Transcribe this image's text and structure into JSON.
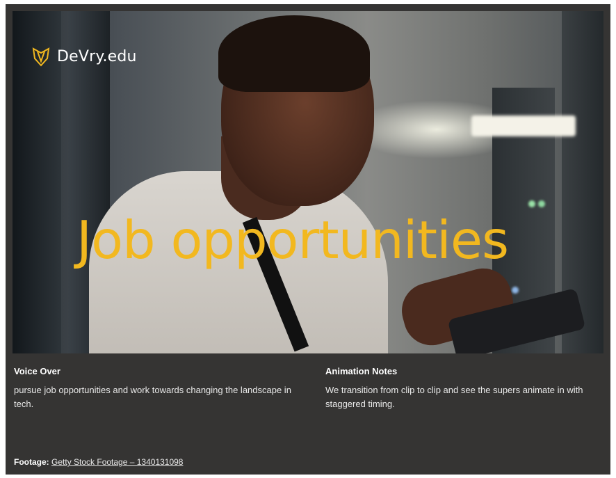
{
  "brand": {
    "name": "DeVry.edu",
    "accent": "#f2b81f"
  },
  "hero": {
    "super_text": "Job opportunities"
  },
  "voice_over": {
    "heading": "Voice Over",
    "text": "pursue job opportunities and work towards changing the landscape in tech."
  },
  "animation_notes": {
    "heading": "Animation Notes",
    "text": "We transition from clip to clip and see the supers animate in with staggered timing."
  },
  "footage": {
    "label": "Footage:",
    "link_text": "Getty Stock Footage – 1340131098"
  },
  "colors": {
    "panel_bg": "#353433",
    "super_yellow": "#f2b81f"
  }
}
